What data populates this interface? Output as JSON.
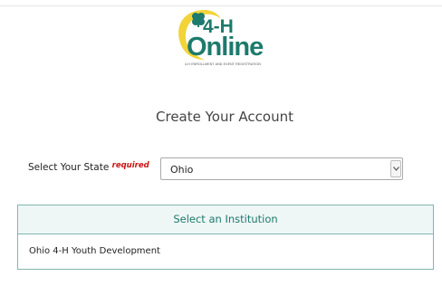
{
  "logo": {
    "brand_top": "4-H",
    "brand_bottom": "Online",
    "tagline": "4-H ENROLLMENT AND EVENT REGISTRATION",
    "colors": {
      "swoosh": "#f2d43a",
      "clover": "#1d7a6c",
      "text": "#1d7a6c"
    },
    "icon": "four-leaf-clover-icon"
  },
  "page": {
    "title": "Create Your Account"
  },
  "state": {
    "label": "Select Your State",
    "required_label": "required",
    "selected": "Ohio"
  },
  "institution": {
    "header": "Select an Institution",
    "items": [
      "Ohio 4-H Youth Development"
    ]
  },
  "theme": {
    "accent": "#1d7a6c",
    "panel_border": "#7fb6b0",
    "required_color": "#cc1111"
  }
}
